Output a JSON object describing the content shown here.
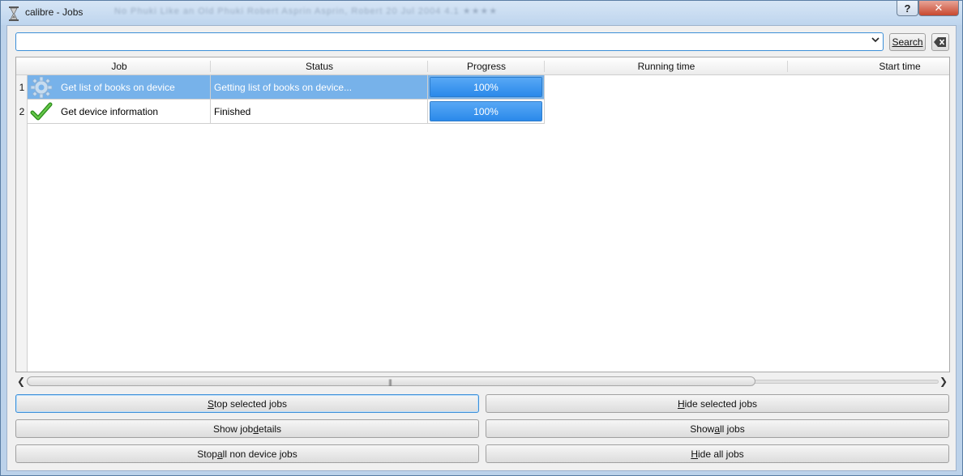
{
  "window": {
    "title": "calibre - Jobs",
    "help_label": "?",
    "close_label": "✕",
    "background_text": "No Phuki Like an Old Phuki   Robert Asprin   Asprin, Robert   20 Jul 2004   4.1   ★★★★"
  },
  "search": {
    "value": "",
    "placeholder": "",
    "search_button": "Search",
    "clear_icon": "clear-text-icon"
  },
  "table": {
    "columns": [
      "Job",
      "Status",
      "Progress",
      "Running time",
      "Start time"
    ],
    "rows": [
      {
        "num": "1",
        "job": "Get list of books on device",
        "icon": "gear-icon",
        "status": "Getting list of books on device...",
        "progress": 1.0,
        "progress_label": "100%",
        "running_time": "",
        "start_time": "",
        "selected": true
      },
      {
        "num": "2",
        "job": "Get device information",
        "icon": "check-icon",
        "status": "Finished",
        "progress": 1.0,
        "progress_label": "100%",
        "running_time": "",
        "start_time": "",
        "selected": false
      }
    ]
  },
  "buttons": {
    "stop_selected": {
      "pre": "",
      "key": "S",
      "post": "top selected jobs"
    },
    "hide_selected": {
      "pre": "",
      "key": "H",
      "post": "ide selected jobs"
    },
    "show_details": {
      "pre": "Show job ",
      "key": "d",
      "post": "etails"
    },
    "show_all": {
      "pre": "Show ",
      "key": "a",
      "post": "ll jobs"
    },
    "stop_all_non_device": {
      "pre": "Stop ",
      "key": "a",
      "post": "ll non device jobs"
    },
    "hide_all": {
      "pre": "",
      "key": "H",
      "post": "ide all jobs"
    }
  },
  "colors": {
    "selection": "#77b2ea",
    "progress": "#2a89ea",
    "focus": "#3c8fd8"
  }
}
